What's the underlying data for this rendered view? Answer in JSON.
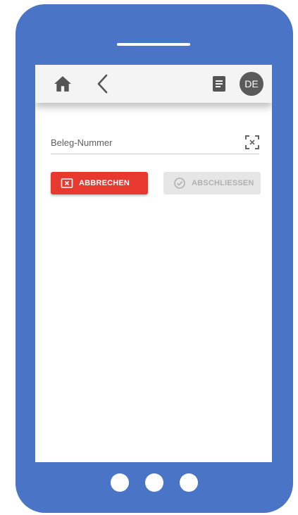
{
  "topbar": {
    "icons": {
      "home": "home-icon",
      "back": "chevron-left-icon",
      "document": "document-icon"
    },
    "language": "DE"
  },
  "form": {
    "field_placeholder": "Beleg-Nummer",
    "field_value": "",
    "scan_icon": "scan-icon"
  },
  "buttons": {
    "cancel_label": "ABBRECHEN",
    "cancel_icon": "close-box-icon",
    "finish_label": "ABSCHLIESSEN",
    "finish_icon": "check-circle-icon",
    "finish_enabled": false
  },
  "colors": {
    "phone_frame": "#4a74c6",
    "cancel": "#e8392f",
    "disabled": "#e6e6e6",
    "avatar": "#5a5a5a"
  }
}
